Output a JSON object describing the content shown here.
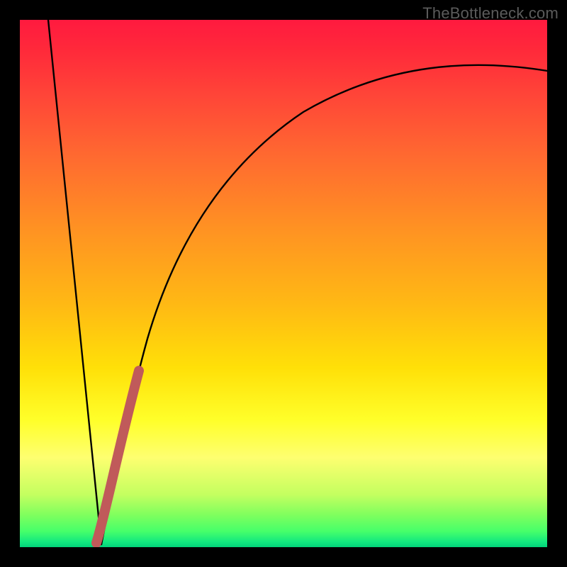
{
  "watermark": "TheBottleneck.com",
  "colors": {
    "frame": "#000000",
    "curve_main": "#000000",
    "curve_highlight": "#c05a5a",
    "gradient_top": "#ff1a3f",
    "gradient_bottom": "#02d37a"
  },
  "chart_data": {
    "type": "line",
    "title": "",
    "xlabel": "",
    "ylabel": "",
    "xlim": [
      0,
      100
    ],
    "ylim": [
      0,
      100
    ],
    "annotations": [],
    "series": [
      {
        "name": "left-falling-line",
        "color": "#000000",
        "x": [
          5,
          15
        ],
        "y": [
          100,
          0
        ]
      },
      {
        "name": "right-curve",
        "color": "#000000",
        "x": [
          15,
          17,
          19,
          21,
          23,
          25,
          28,
          32,
          38,
          45,
          55,
          65,
          75,
          85,
          95,
          100
        ],
        "y": [
          0,
          11,
          21,
          29,
          36,
          42,
          50,
          58,
          66,
          73,
          79,
          83,
          86,
          88,
          89.5,
          90
        ]
      },
      {
        "name": "highlight-segment",
        "color": "#c05a5a",
        "x": [
          15,
          22
        ],
        "y": [
          0,
          33
        ]
      }
    ]
  }
}
